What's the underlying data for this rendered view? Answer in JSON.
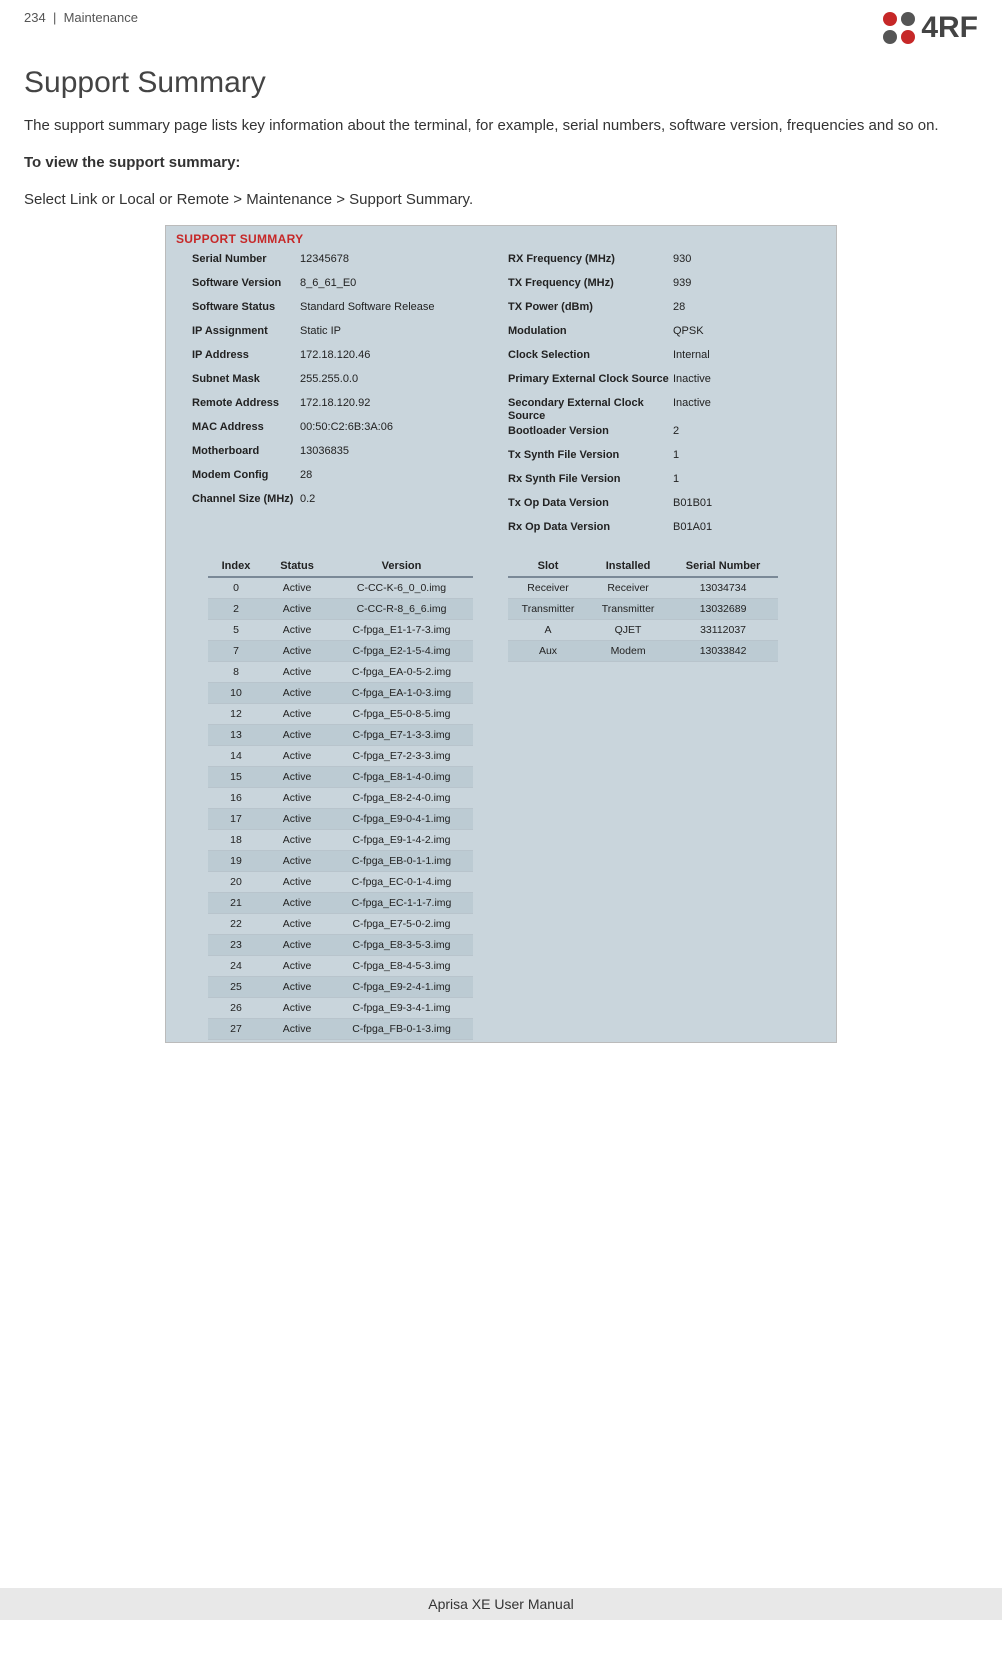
{
  "header": {
    "page_num": "234",
    "sep": "|",
    "section": "Maintenance",
    "logo_text": "4RF"
  },
  "title": "Support Summary",
  "para1": "The support summary page lists key information about the terminal, for example, serial numbers, software version, frequencies and so on.",
  "howto_label": "To view the support summary:",
  "howto_path": "Select Link or Local or Remote > Maintenance > Support Summary.",
  "panel_title": "SUPPORT SUMMARY",
  "left_kv": [
    {
      "k": "Serial Number",
      "v": "12345678"
    },
    {
      "k": "Software Version",
      "v": "8_6_61_E0"
    },
    {
      "k": "Software Status",
      "v": "Standard Software Release"
    },
    {
      "k": "IP Assignment",
      "v": "Static IP"
    },
    {
      "k": "IP Address",
      "v": "172.18.120.46"
    },
    {
      "k": "Subnet Mask",
      "v": "255.255.0.0"
    },
    {
      "k": "Remote Address",
      "v": "172.18.120.92"
    },
    {
      "k": "MAC Address",
      "v": "00:50:C2:6B:3A:06"
    },
    {
      "k": "Motherboard",
      "v": "13036835"
    },
    {
      "k": "Modem Config",
      "v": "28"
    },
    {
      "k": "Channel Size (MHz)",
      "v": "0.2"
    }
  ],
  "right_kv": [
    {
      "k": "RX Frequency (MHz)",
      "v": "930"
    },
    {
      "k": "TX Frequency (MHz)",
      "v": "939"
    },
    {
      "k": "TX Power (dBm)",
      "v": "28"
    },
    {
      "k": "Modulation",
      "v": "QPSK"
    },
    {
      "k": "Clock Selection",
      "v": "Internal"
    },
    {
      "k": "Primary External Clock Source",
      "v": "Inactive"
    },
    {
      "k": "Secondary External Clock Source",
      "v": "Inactive"
    },
    {
      "k": "Bootloader Version",
      "v": "2"
    },
    {
      "k": "Tx Synth File Version",
      "v": "1"
    },
    {
      "k": "Rx Synth File Version",
      "v": "1"
    },
    {
      "k": "Tx Op Data Version",
      "v": "B01B01"
    },
    {
      "k": "Rx Op Data Version",
      "v": "B01A01"
    }
  ],
  "file_table": {
    "headers": [
      "Index",
      "Status",
      "Version"
    ],
    "rows": [
      {
        "i": "0",
        "s": "Active",
        "v": "C-CC-K-6_0_0.img"
      },
      {
        "i": "2",
        "s": "Active",
        "v": "C-CC-R-8_6_6.img"
      },
      {
        "i": "5",
        "s": "Active",
        "v": "C-fpga_E1-1-7-3.img"
      },
      {
        "i": "7",
        "s": "Active",
        "v": "C-fpga_E2-1-5-4.img"
      },
      {
        "i": "8",
        "s": "Active",
        "v": "C-fpga_EA-0-5-2.img"
      },
      {
        "i": "10",
        "s": "Active",
        "v": "C-fpga_EA-1-0-3.img"
      },
      {
        "i": "12",
        "s": "Active",
        "v": "C-fpga_E5-0-8-5.img"
      },
      {
        "i": "13",
        "s": "Active",
        "v": "C-fpga_E7-1-3-3.img"
      },
      {
        "i": "14",
        "s": "Active",
        "v": "C-fpga_E7-2-3-3.img"
      },
      {
        "i": "15",
        "s": "Active",
        "v": "C-fpga_E8-1-4-0.img"
      },
      {
        "i": "16",
        "s": "Active",
        "v": "C-fpga_E8-2-4-0.img"
      },
      {
        "i": "17",
        "s": "Active",
        "v": "C-fpga_E9-0-4-1.img"
      },
      {
        "i": "18",
        "s": "Active",
        "v": "C-fpga_E9-1-4-2.img"
      },
      {
        "i": "19",
        "s": "Active",
        "v": "C-fpga_EB-0-1-1.img"
      },
      {
        "i": "20",
        "s": "Active",
        "v": "C-fpga_EC-0-1-4.img"
      },
      {
        "i": "21",
        "s": "Active",
        "v": "C-fpga_EC-1-1-7.img"
      },
      {
        "i": "22",
        "s": "Active",
        "v": "C-fpga_E7-5-0-2.img"
      },
      {
        "i": "23",
        "s": "Active",
        "v": "C-fpga_E8-3-5-3.img"
      },
      {
        "i": "24",
        "s": "Active",
        "v": "C-fpga_E8-4-5-3.img"
      },
      {
        "i": "25",
        "s": "Active",
        "v": "C-fpga_E9-2-4-1.img"
      },
      {
        "i": "26",
        "s": "Active",
        "v": "C-fpga_E9-3-4-1.img"
      },
      {
        "i": "27",
        "s": "Active",
        "v": "C-fpga_FB-0-1-3.img"
      }
    ]
  },
  "slot_table": {
    "headers": [
      "Slot",
      "Installed",
      "Serial Number"
    ],
    "rows": [
      {
        "a": "Receiver",
        "b": "Receiver",
        "c": "13034734"
      },
      {
        "a": "Transmitter",
        "b": "Transmitter",
        "c": "13032689"
      },
      {
        "a": "A",
        "b": "QJET",
        "c": "33112037"
      },
      {
        "a": "Aux",
        "b": "Modem",
        "c": "13033842"
      }
    ]
  },
  "footer": "Aprisa XE User Manual"
}
